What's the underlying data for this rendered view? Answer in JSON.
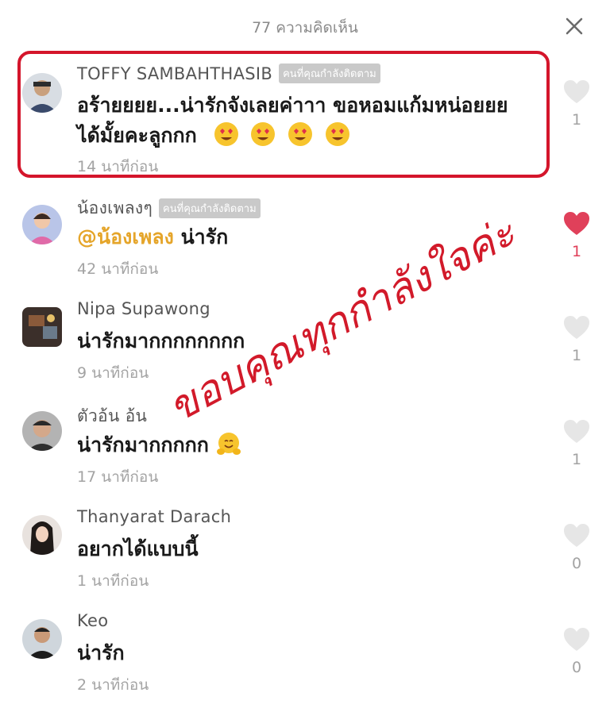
{
  "header": {
    "title": "77 ความคิดเห็น",
    "close_icon": "close-icon"
  },
  "overlay_text": "ขอบคุณทุกกำลังใจค่ะ",
  "colors": {
    "highlight": "#d4152b",
    "liked": "#e0405a",
    "mention": "#e5a52a"
  },
  "comments": [
    {
      "name": "TOFFY SAMBAHTHASIB",
      "badge": "คนที่คุณกำลังติดตาม",
      "body_line1": "อร้ายยยย...น่ารักจังเลยค่าาา ขอหอมแก้มหน่อยยย",
      "body_line2": "ได้มั้ยคะลูกกก",
      "emojis": [
        "heart-eyes-emoji",
        "heart-eyes-emoji",
        "heart-eyes-emoji",
        "heart-eyes-emoji"
      ],
      "time": "14 นาทีก่อน",
      "likes": "1",
      "liked": false
    },
    {
      "name": "น้องเพลงๆ",
      "badge": "คนที่คุณกำลังติดตาม",
      "mention": "@น้องเพลง",
      "body": "น่ารัก",
      "time": "42 นาทีก่อน",
      "likes": "1",
      "liked": true
    },
    {
      "name": "Nipa Supawong",
      "body": "น่ารักมากกกกกกกก",
      "time": "9 นาทีก่อน",
      "likes": "1",
      "liked": false
    },
    {
      "name": "ตัวอ้น อ้น",
      "body": "น่ารักมากกกกก",
      "emojis": [
        "hugging-face-emoji"
      ],
      "time": "17 นาทีก่อน",
      "likes": "1",
      "liked": false
    },
    {
      "name": "Thanyarat Darach",
      "body": "อยากได้แบบนี้",
      "time": "1 นาทีก่อน",
      "likes": "0",
      "liked": false
    },
    {
      "name": "Keo",
      "body": "น่ารัก",
      "time": "2 นาทีก่อน",
      "likes": "0",
      "liked": false
    }
  ]
}
